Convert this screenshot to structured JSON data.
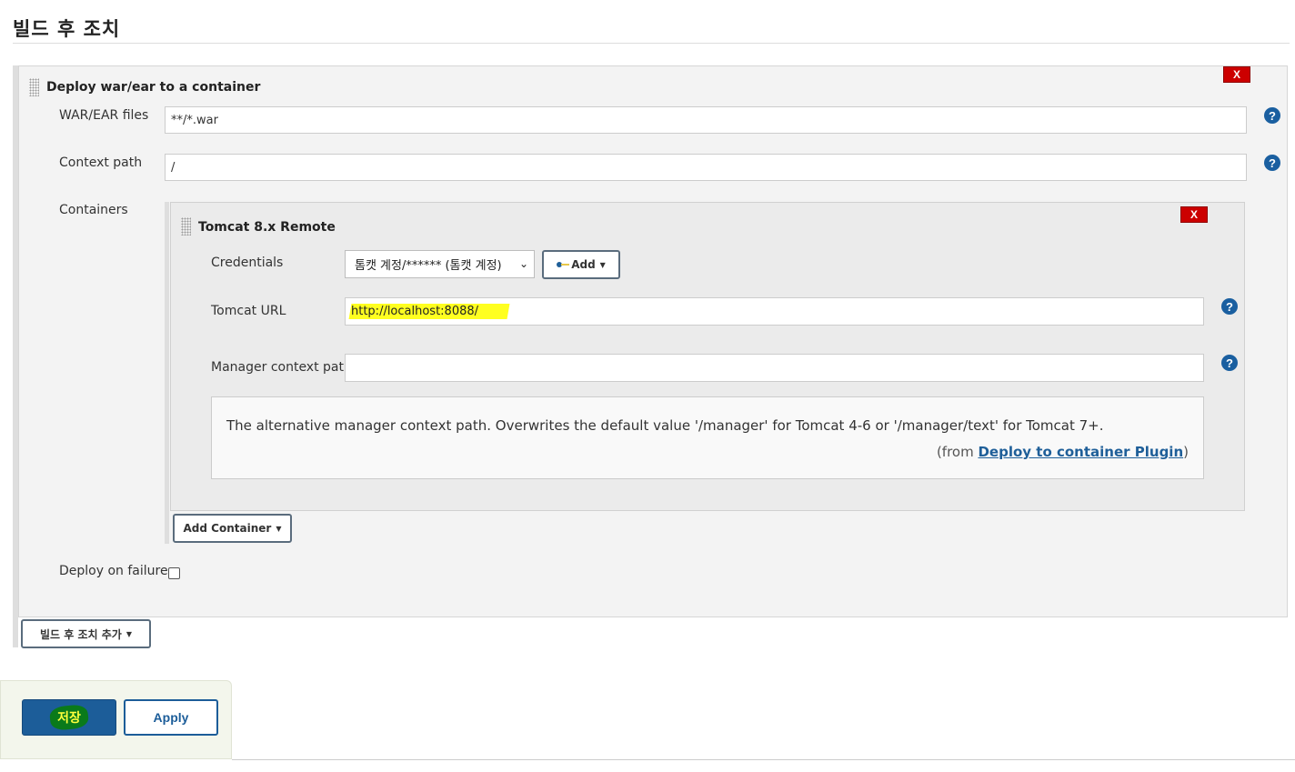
{
  "section": {
    "title": "빌드 후 조치"
  },
  "deploy_step": {
    "title": "Deploy war/ear to a container",
    "delete_label": "X",
    "war_files": {
      "label": "WAR/EAR files",
      "value": "**/*.war"
    },
    "context_path": {
      "label": "Context path",
      "value": "/"
    },
    "containers_label": "Containers",
    "add_container_label": "Add Container",
    "deploy_on_failure_label": "Deploy on failure",
    "help_icon": "?"
  },
  "tomcat": {
    "title": "Tomcat 8.x Remote",
    "delete_label": "X",
    "credentials": {
      "label": "Credentials",
      "selected": "톰캣 계정/****** (톰캣 계정)",
      "add_label": "Add"
    },
    "url": {
      "label": "Tomcat URL",
      "value": "http://localhost:8088/"
    },
    "manager_context": {
      "label": "Manager context path",
      "value": ""
    },
    "help": {
      "text": "The alternative manager context path. Overwrites the default value '/manager' for Tomcat 4-6 or '/manager/text' for Tomcat 7+.",
      "from_prefix": "(from ",
      "link_text": "Deploy to container Plugin",
      "from_suffix": ")"
    }
  },
  "add_post_build_label": "빌드 후 조치 추가",
  "footer": {
    "save_label": "저장",
    "apply_label": "Apply"
  },
  "colors": {
    "primary": "#1c5d99",
    "delete": "#cc0000",
    "highlight_yellow": "#ffff20",
    "highlight_green": "#0a7a1a"
  }
}
